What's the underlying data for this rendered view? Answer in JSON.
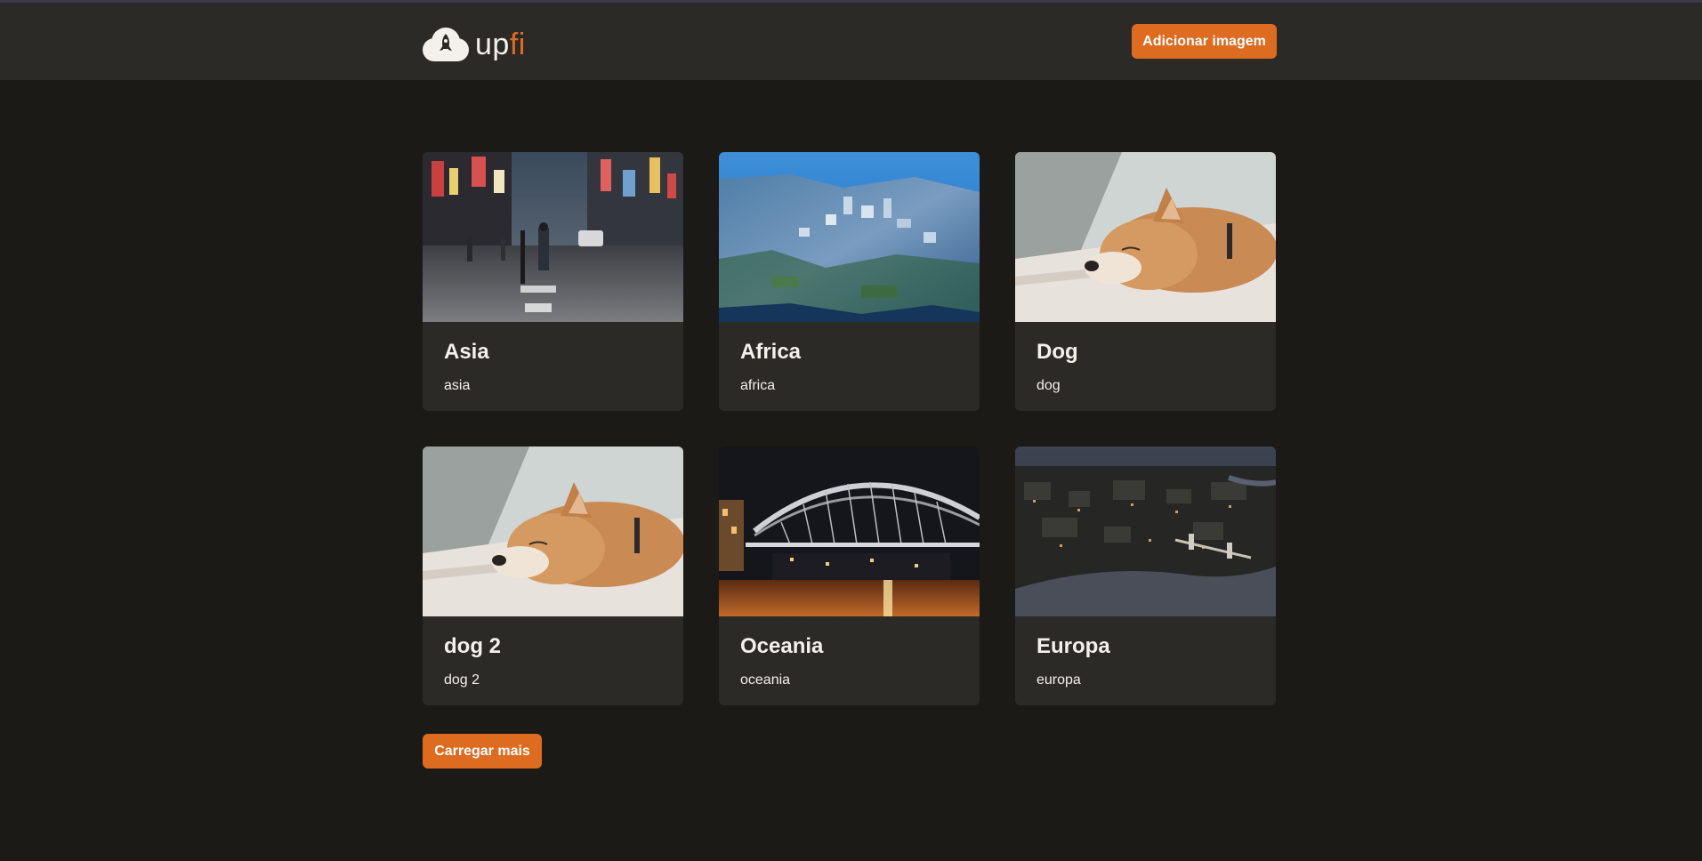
{
  "header": {
    "logo": {
      "text_main": "up",
      "text_accent": "fi"
    },
    "add_button_label": "Adicionar imagem"
  },
  "cards": [
    {
      "title": "Asia",
      "description": "asia",
      "image": "city-street-night-photo"
    },
    {
      "title": "Africa",
      "description": "africa",
      "image": "aerial-coastal-city-photo"
    },
    {
      "title": "Dog",
      "description": "dog",
      "image": "sleeping-shiba-dog-photo"
    },
    {
      "title": "dog 2",
      "description": "dog 2",
      "image": "sleeping-shiba-dog-photo"
    },
    {
      "title": "Oceania",
      "description": "oceania",
      "image": "harbour-bridge-night-photo"
    },
    {
      "title": "Europa",
      "description": "europa",
      "image": "aerial-city-river-night-photo"
    }
  ],
  "load_more_label": "Carregar mais",
  "colors": {
    "background": "#1b1a17",
    "header": "#2c2a26",
    "card": "#2c2a26",
    "accent": "#dd6b20",
    "text": "#f4f0ec"
  }
}
